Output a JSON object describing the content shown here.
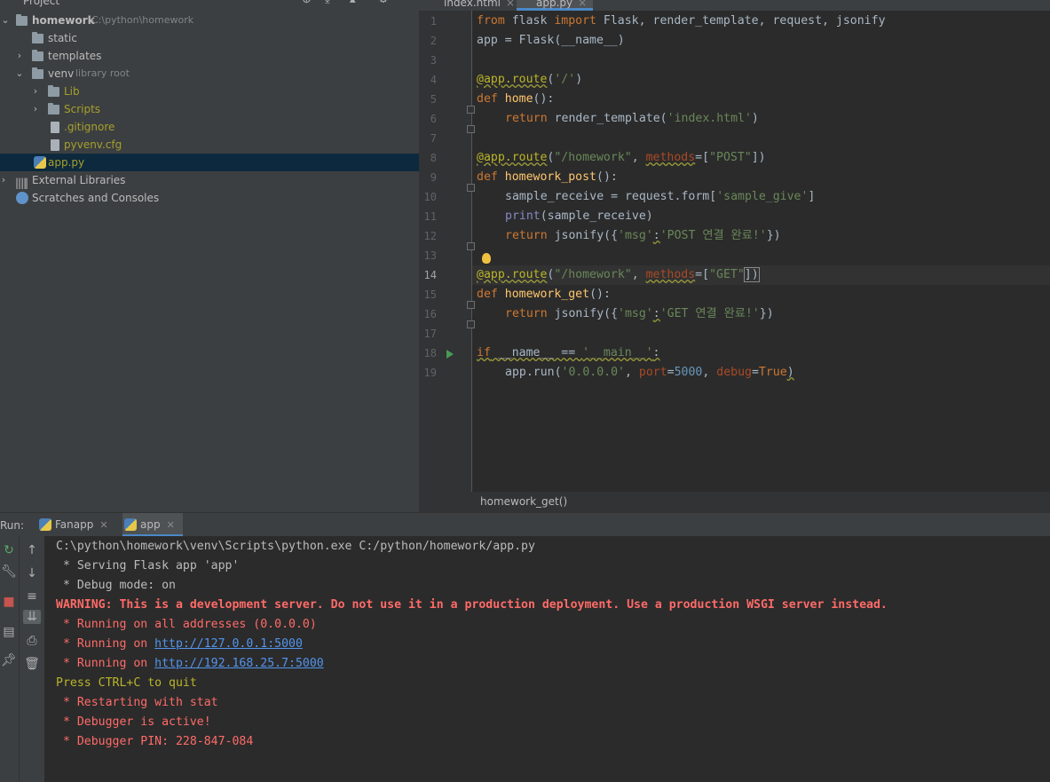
{
  "project": {
    "title": "Project",
    "tree": [
      {
        "label": "homework",
        "hint": "C:\\python\\homework",
        "type": "folder",
        "expanded": true
      },
      {
        "label": "static",
        "type": "folder"
      },
      {
        "label": "templates",
        "type": "folder"
      },
      {
        "label": "venv",
        "hint": "library root",
        "type": "folder",
        "expanded": true
      },
      {
        "label": "Lib",
        "type": "folder"
      },
      {
        "label": "Scripts",
        "type": "folder"
      },
      {
        "label": ".gitignore",
        "type": "file"
      },
      {
        "label": "pyvenv.cfg",
        "type": "file"
      },
      {
        "label": "app.py",
        "type": "python"
      },
      {
        "label": "External Libraries",
        "type": "library"
      },
      {
        "label": "Scratches and Consoles",
        "type": "scratch"
      }
    ]
  },
  "editor": {
    "tabs": [
      {
        "label": "index.html",
        "active": false
      },
      {
        "label": "app.py",
        "active": true
      }
    ],
    "current_line": 14,
    "line_numbers": [
      "1",
      "2",
      "3",
      "4",
      "5",
      "6",
      "7",
      "8",
      "9",
      "10",
      "11",
      "12",
      "13",
      "14",
      "15",
      "16",
      "17",
      "18",
      "19"
    ],
    "breadcrumb": "homework_get()"
  },
  "code_tokens": {
    "l1": [
      "from",
      " flask ",
      "import",
      " Flask, render_template, request, jsonify"
    ],
    "l2": "app = Flask(__name__)",
    "l4": [
      "@app.route",
      "(",
      "'/'",
      ")"
    ],
    "l5": [
      "def",
      " ",
      "home",
      "():"
    ],
    "l6": [
      "return",
      " render_template(",
      "'index.html'",
      ")"
    ],
    "l8": [
      "@app.route",
      "(",
      "\"/homework\"",
      ", ",
      "methods",
      "=[",
      "\"POST\"",
      "])"
    ],
    "l9": [
      "def",
      " ",
      "homework_post",
      "():"
    ],
    "l10": [
      "sample_receive = request.form[",
      "'sample_give'",
      "]"
    ],
    "l11": [
      "print",
      "(sample_receive)"
    ],
    "l12": [
      "return",
      " jsonify({",
      "'msg'",
      ":",
      "'POST 연결 완료!'",
      "})"
    ],
    "l14": [
      "@app.route",
      "(",
      "\"/homework\"",
      ", ",
      "methods",
      "=[",
      "\"GET\"",
      "])"
    ],
    "l15": [
      "def",
      " ",
      "homework_get",
      "():"
    ],
    "l16": [
      "return",
      " jsonify({",
      "'msg'",
      ":",
      "'GET 연결 완료!'",
      "})"
    ],
    "l18": [
      "if",
      " __name__ == ",
      "'__main__'",
      ":"
    ],
    "l19": [
      "app.run(",
      "'0.0.0.0'",
      ", ",
      "port",
      "=",
      "5000",
      ", ",
      "debug",
      "=",
      "True",
      ")"
    ]
  },
  "run": {
    "label": "Run:",
    "tabs": [
      {
        "label": "Fanapp",
        "active": false
      },
      {
        "label": "app",
        "active": true
      }
    ],
    "console": {
      "cmd": "C:\\python\\homework\\venv\\Scripts\\python.exe C:/python/homework/app.py",
      "serving": " * Serving Flask app 'app'",
      "debug_mode": " * Debug mode: on",
      "warning": "WARNING: This is a development server. Do not use it in a production deployment. Use a production WSGI server instead.",
      "running_all": " * Running on all addresses (0.0.0.0)",
      "running_prefix": " * Running on ",
      "link1": "http://127.0.0.1:5000",
      "link2": "http://192.168.25.7:5000",
      "quit": "Press CTRL+C to quit",
      "restart": " * Restarting with stat",
      "debugger_active": " * Debugger is active!",
      "debugger_pin": " * Debugger PIN: 228-847-084"
    }
  },
  "colors": {
    "keyword": "#cc7832",
    "decorator": "#bbb529",
    "string": "#6a8759",
    "function": "#ffc66d",
    "number": "#6897bb",
    "error": "#ff6b68",
    "link": "#5394ec",
    "selection": "#0d293e"
  }
}
